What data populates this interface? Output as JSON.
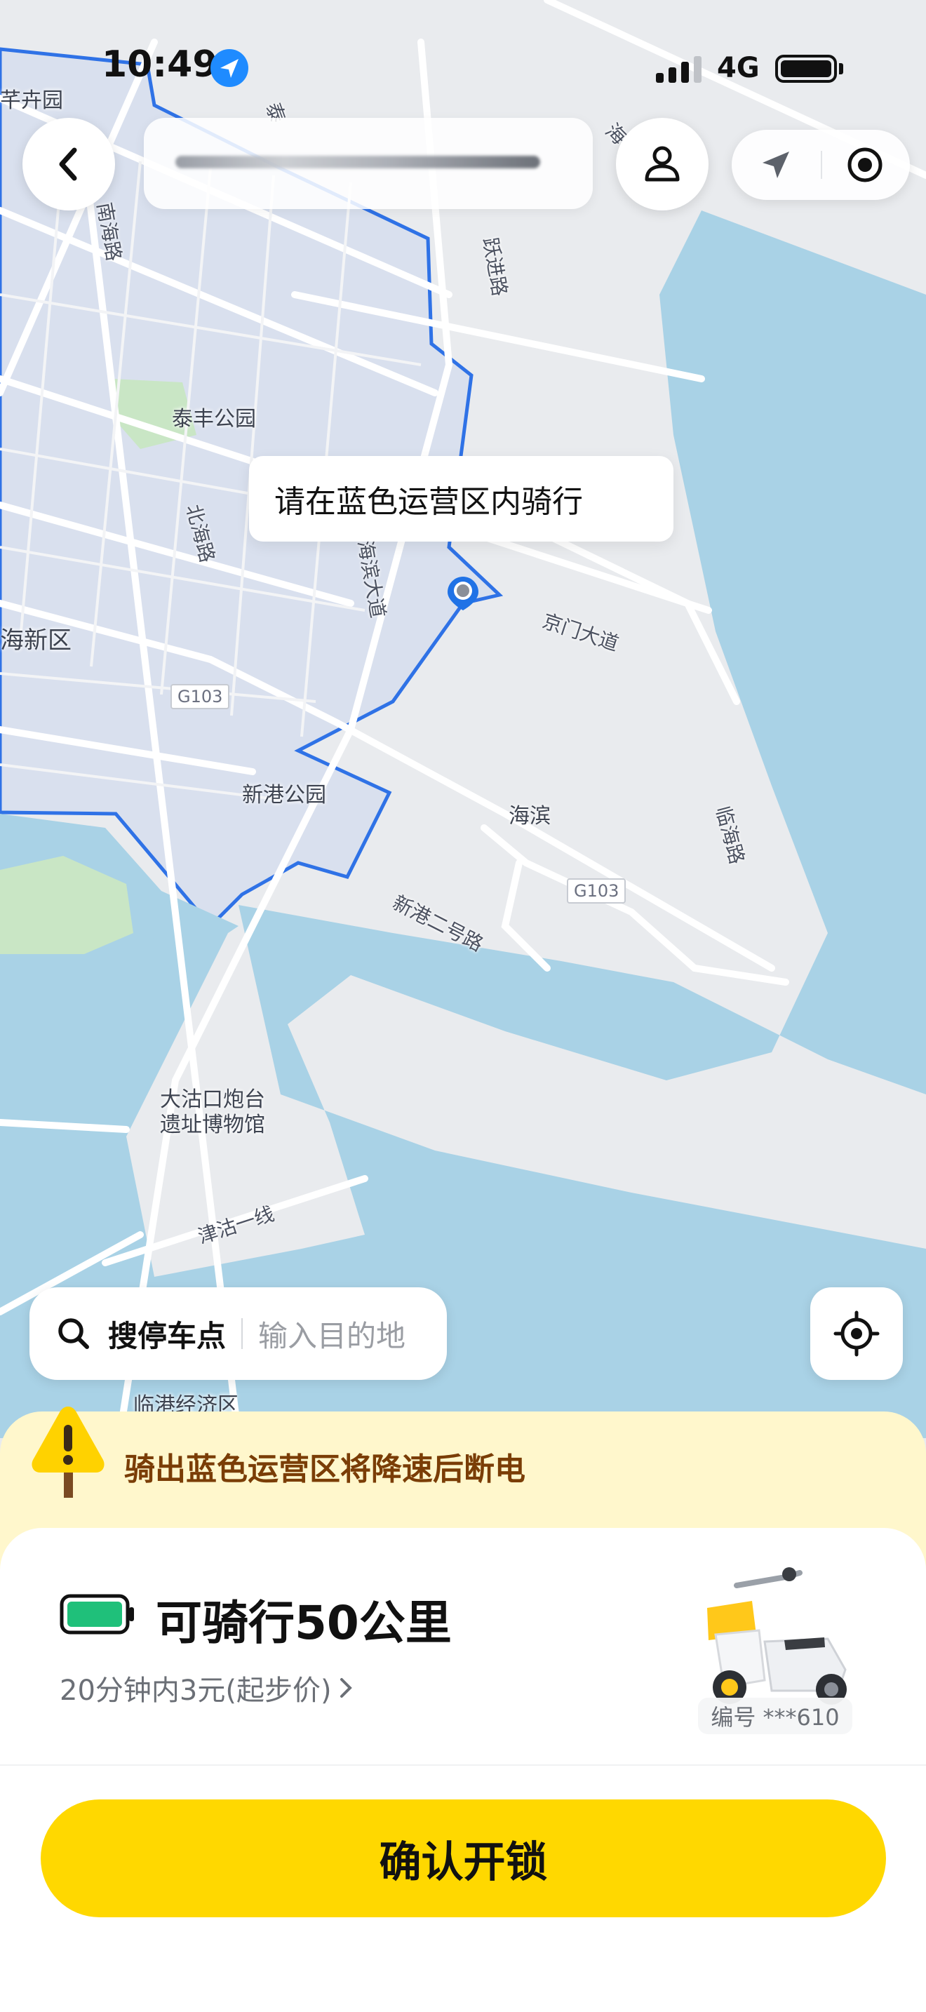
{
  "status_bar": {
    "time": "10:49",
    "network": "4G",
    "icon_location": "location-arrow-icon",
    "icon_signal": "signal-icon",
    "icon_battery": "battery-icon"
  },
  "header": {
    "back_icon": "back-chevron-icon",
    "user_icon": "user-icon",
    "navigate_icon": "navigate-arrow-icon",
    "target_icon": "target-icon"
  },
  "map": {
    "tooltip": "请在蓝色运营区内骑行",
    "place_labels": {
      "taifeng_park": "泰丰公园",
      "xingang_park": "新港公园",
      "haibin": "海滨",
      "dagukou_museum_1": "大沽口炮台",
      "dagukou_museum_2": "遗址博物馆",
      "lingang": "临港经济区",
      "xinqu": "海新区",
      "fenghuiyuan": "芊卉园"
    },
    "road_labels": {
      "jingmen": "京门大道",
      "haibin_dadao": "海滨大道",
      "beihai": "北海路",
      "nanhai": "南海路",
      "yuejin": "跃进路",
      "linhai": "临海路",
      "xingang2": "新港二号路",
      "jingu1": "津沽一线",
      "tai": "泰",
      "hai": "海"
    },
    "highway_badges": {
      "g103_a": "G103",
      "g103_b": "G103"
    },
    "colors": {
      "zone_border": "#2f72e6",
      "zone_fill": "#d9e0ee",
      "water": "#a9d2e6",
      "land": "#e9ebee",
      "road": "#ffffff",
      "park": "#c9e6c5"
    }
  },
  "search": {
    "icon": "search-icon",
    "label": "搜停车点",
    "placeholder": "输入目的地",
    "recenter_icon": "crosshair-icon"
  },
  "warning": {
    "icon": "warning-sign-icon",
    "text": "骑出蓝色运营区将降速后断电",
    "color": "#7a3d06"
  },
  "ride": {
    "battery_icon": "battery-green-icon",
    "battery_color": "#1fc07a",
    "range": "可骑行50公里",
    "price": "20分钟内3元(起步价)",
    "price_chevron": "chevron-right-icon",
    "bike_number": "编号 ***610",
    "scooter_image": "scooter-image"
  },
  "cta": {
    "label": "确认开锁",
    "color": "#ffd800"
  }
}
